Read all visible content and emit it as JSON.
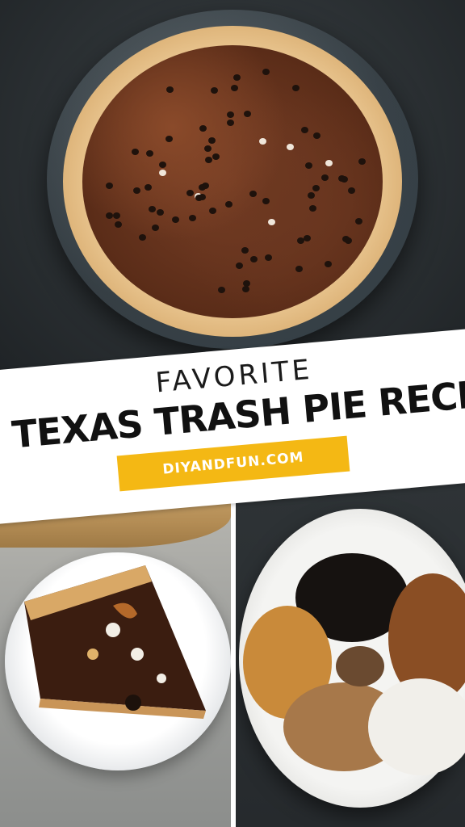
{
  "banner": {
    "title_top": "FAVORITE",
    "title_main": "TEXAS TRASH PIE RECIPE",
    "site": "DIYANDFUN.COM"
  },
  "colors": {
    "banner_bg": "#ffffff",
    "site_band": "#f4b814",
    "title_text": "#111111"
  },
  "images": [
    {
      "name": "whole-pie-photo",
      "depicts": "whole pie"
    },
    {
      "name": "pie-slice-photo",
      "depicts": "pie slice on plate"
    },
    {
      "name": "ingredients-bowl-photo",
      "depicts": "ingredients bowl"
    }
  ]
}
